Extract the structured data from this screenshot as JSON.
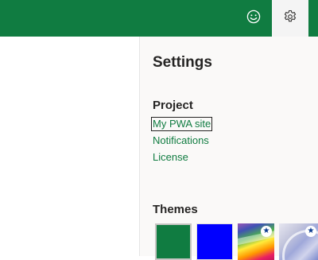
{
  "header": {
    "background_color": "#107c41",
    "feedback_icon": "smiley-icon",
    "settings_icon": "gear-icon"
  },
  "settings_panel": {
    "title": "Settings",
    "project": {
      "heading": "Project",
      "links": [
        "My PWA site",
        "Notifications",
        "License"
      ]
    },
    "themes": {
      "heading": "Themes",
      "swatches": [
        {
          "name": "green",
          "color": "#107c41",
          "selected": true
        },
        {
          "name": "blue",
          "color": "#0000ff",
          "selected": false
        },
        {
          "name": "rainbow",
          "icon": "star-icon",
          "selected": false
        },
        {
          "name": "silver",
          "icon": "star-icon",
          "selected": false
        }
      ]
    }
  }
}
